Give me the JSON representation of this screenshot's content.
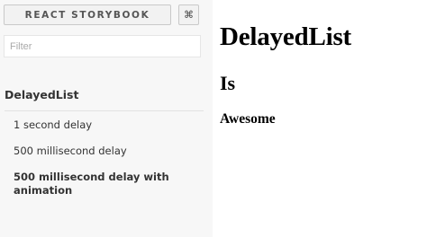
{
  "sidebar": {
    "brand_label": "REACT STORYBOOK",
    "shortcut_icon": "command-icon",
    "shortcut_glyph": "⌘",
    "filter_placeholder": "Filter",
    "filter_value": "",
    "kind_title": "DelayedList",
    "stories": [
      {
        "label": "1 second delay",
        "selected": false
      },
      {
        "label": "500 millisecond delay",
        "selected": false
      },
      {
        "label": "500 millisecond delay with animation",
        "selected": true
      }
    ]
  },
  "preview": {
    "heading_1": "DelayedList",
    "heading_2": "Is",
    "heading_3": "Awesome"
  }
}
